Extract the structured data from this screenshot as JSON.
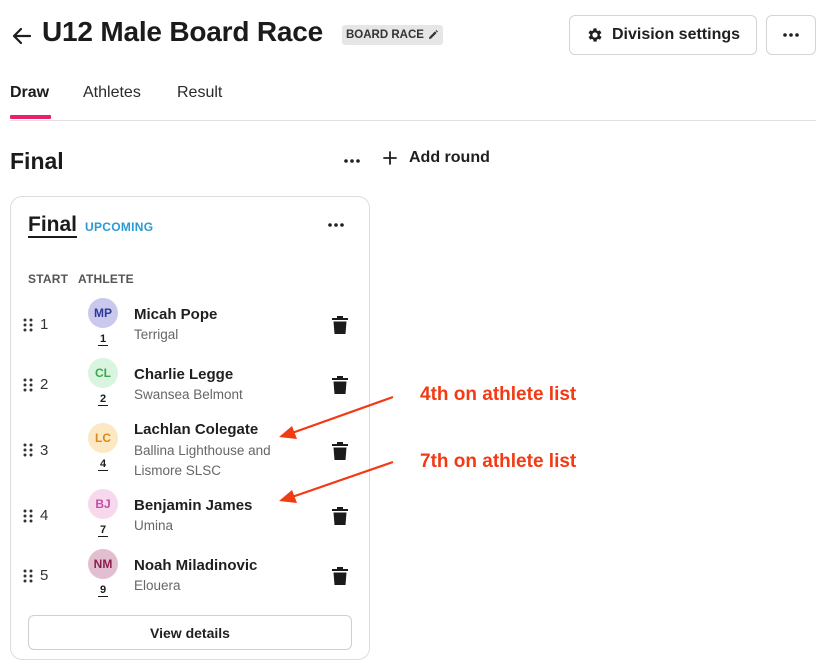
{
  "header": {
    "title": "U12 Male Board Race",
    "badge": "BOARD RACE",
    "settings_label": "Division settings"
  },
  "tabs": [
    {
      "label": "Draw",
      "active": true
    },
    {
      "label": "Athletes",
      "active": false
    },
    {
      "label": "Result",
      "active": false
    }
  ],
  "round": {
    "title": "Final",
    "add_round_label": "Add round"
  },
  "heat": {
    "name": "Final",
    "status": "UPCOMING",
    "columns": {
      "start": "START",
      "athlete": "ATHLETE"
    },
    "view_details_label": "View details",
    "entries": [
      {
        "start": "1",
        "initials": "MP",
        "bib": "1",
        "name": "Micah Pope",
        "club": "Terrigal",
        "avatar_bg": "#c9c9ee",
        "avatar_fg": "#2b3a9a"
      },
      {
        "start": "2",
        "initials": "CL",
        "bib": "2",
        "name": "Charlie Legge",
        "club": "Swansea Belmont",
        "avatar_bg": "#daf5df",
        "avatar_fg": "#3aa852"
      },
      {
        "start": "3",
        "initials": "LC",
        "bib": "4",
        "name": "Lachlan Colegate",
        "club": "Ballina Lighthouse and Lismore SLSC",
        "avatar_bg": "#fde8c4",
        "avatar_fg": "#d98a1c"
      },
      {
        "start": "4",
        "initials": "BJ",
        "bib": "7",
        "name": "Benjamin James",
        "club": "Umina",
        "avatar_bg": "#f7d9ee",
        "avatar_fg": "#c24ea3"
      },
      {
        "start": "5",
        "initials": "NM",
        "bib": "9",
        "name": "Noah Miladinovic",
        "club": "Elouera",
        "avatar_bg": "#e2bfd0",
        "avatar_fg": "#8a1f4e"
      }
    ]
  },
  "annotations": {
    "first": "4th on athlete list",
    "second": "7th on athlete list",
    "color": "#f23a14"
  },
  "colors": {
    "accent": "#e8206e",
    "status": "#2a9ad4"
  }
}
